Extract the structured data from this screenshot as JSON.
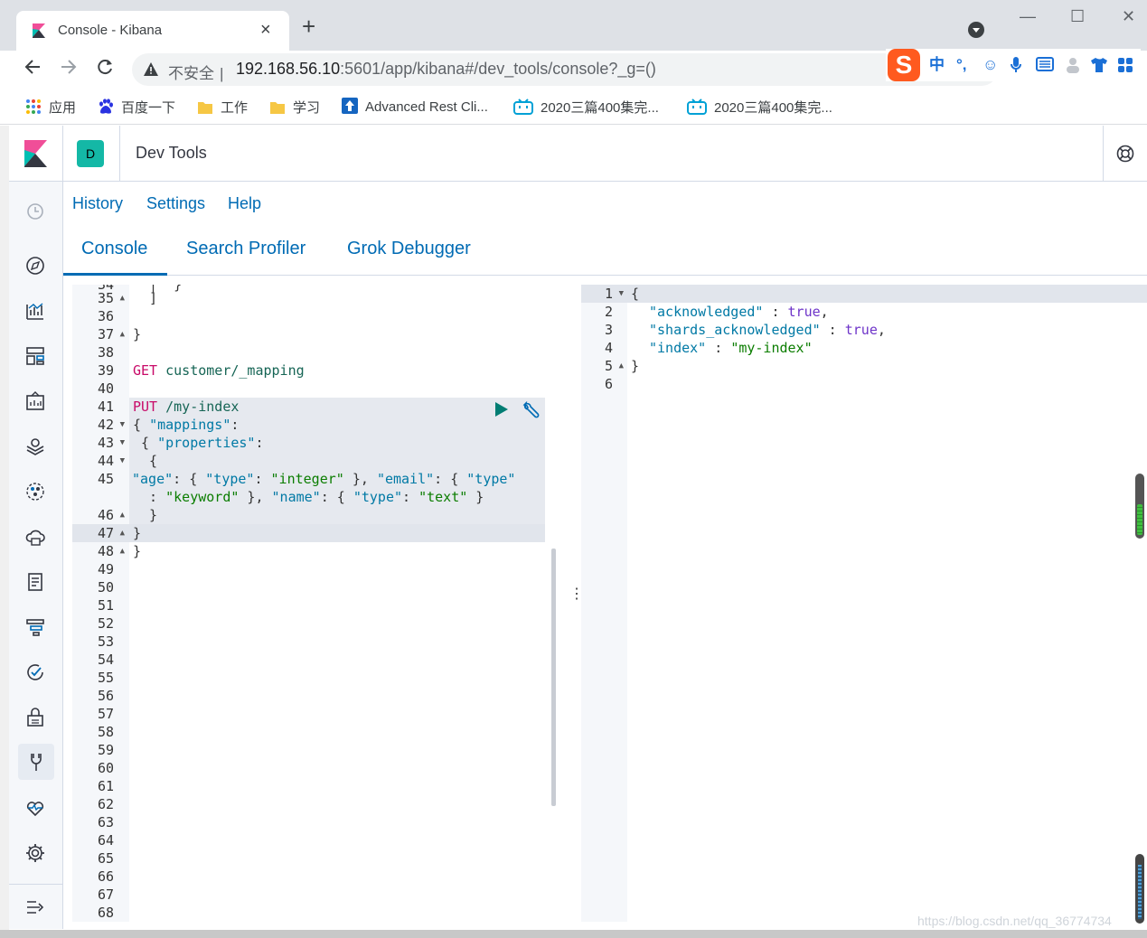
{
  "browser": {
    "tab_title": "Console - Kibana",
    "tab_close": "×",
    "new_tab": "+",
    "win_min": "—",
    "win_max": "☐",
    "win_close": "✕",
    "insecure_label": "不安全",
    "url_host": "192.168.56.10",
    "url_rest": ":5601/app/kibana#/dev_tools/console?_g=()",
    "ime_logo": "S",
    "ime_icons": [
      "中",
      "°,",
      "☺",
      "🎤",
      "▦",
      "♟",
      "👕",
      "✚"
    ],
    "bookmarks": [
      {
        "label": "应用",
        "icon": "apps-grid-icon"
      },
      {
        "label": "百度一下",
        "icon": "baidu-paw-icon"
      },
      {
        "label": "工作",
        "icon": "folder-icon"
      },
      {
        "label": "学习",
        "icon": "folder-icon"
      },
      {
        "label": "Advanced Rest Cli...",
        "icon": "rest-client-icon"
      },
      {
        "label": "2020三篇400集完...",
        "icon": "bilibili-tv-icon"
      },
      {
        "label": "2020三篇400集完...",
        "icon": "bilibili-tv-icon"
      }
    ],
    "colors": {
      "tabstrip": "#dee1e6",
      "accent": "#006bb4",
      "space_avatar": "#14b8a6"
    }
  },
  "kibana": {
    "header_title": "Dev Tools",
    "space_initial": "D",
    "top_links": [
      "History",
      "Settings",
      "Help"
    ],
    "tabs": [
      "Console",
      "Search Profiler",
      "Grok Debugger"
    ],
    "selected_tab": "Console",
    "sidenav_icons": [
      "recent-clock-icon",
      "discover-compass-icon",
      "visualize-chart-icon",
      "dashboard-icon",
      "canvas-icon",
      "maps-icon",
      "ml-icon",
      "infrastructure-icon",
      "logs-icon",
      "apm-icon",
      "uptime-icon",
      "siem-icon",
      "dev-tools-icon",
      "monitoring-icon",
      "management-gear-icon",
      "collapse-nav-icon"
    ]
  },
  "editor": {
    "line_numbers": [
      "34",
      "35",
      "36",
      "37",
      "38",
      "39",
      "40",
      "41",
      "42",
      "43",
      "44",
      "45",
      "",
      "46",
      "47",
      "48",
      "49",
      "50",
      "51",
      "52",
      "53",
      "54",
      "55",
      "56",
      "57",
      "58",
      "59",
      "60",
      "61",
      "62",
      "63",
      "64",
      "65",
      "66",
      "67",
      "68"
    ],
    "top_partial": "  |  }",
    "l35": "  ]",
    "l37": "}",
    "l39_method": "GET",
    "l39_url": "customer/_mapping",
    "l41_method": "PUT",
    "l41_url": "/my-index",
    "l42_open": "{ ",
    "l42_key": "\"mappings\"",
    "l42_colon": ":",
    "l43_open": " { ",
    "l43_key": "\"properties\"",
    "l43_colon": ":",
    "l44": "  {",
    "l45_a_key": "\"age\"",
    "l45_a_1": ": { ",
    "l45_a_type": "\"type\"",
    "l45_a_2": ": ",
    "l45_a_val": "\"integer\"",
    "l45_a_3": " }, ",
    "l45_a_email": "\"email\"",
    "l45_a_4": ": { ",
    "l45_a_type2": "\"type\"",
    "l45_b_1": "  : ",
    "l45_b_val": "\"keyword\"",
    "l45_b_2": " }, ",
    "l45_b_name": "\"name\"",
    "l45_b_3": ": { ",
    "l45_b_type": "\"type\"",
    "l45_b_4": ": ",
    "l45_b_text": "\"text\"",
    "l45_b_5": " }",
    "l46": "  }",
    "l47": "}",
    "l48": "}"
  },
  "output": {
    "line_numbers": [
      "1",
      "2",
      "3",
      "4",
      "5",
      "6"
    ],
    "l1": "{",
    "l2_key": "\"acknowledged\"",
    "l2_sep": " : ",
    "l2_val": "true",
    "l2_end": ",",
    "l3_key": "\"shards_acknowledged\"",
    "l3_sep": " : ",
    "l3_val": "true",
    "l3_end": ",",
    "l4_key": "\"index\"",
    "l4_sep": " : ",
    "l4_val": "\"my-index\"",
    "l5": "}"
  },
  "watermark": "https://blog.csdn.net/qq_36774734"
}
